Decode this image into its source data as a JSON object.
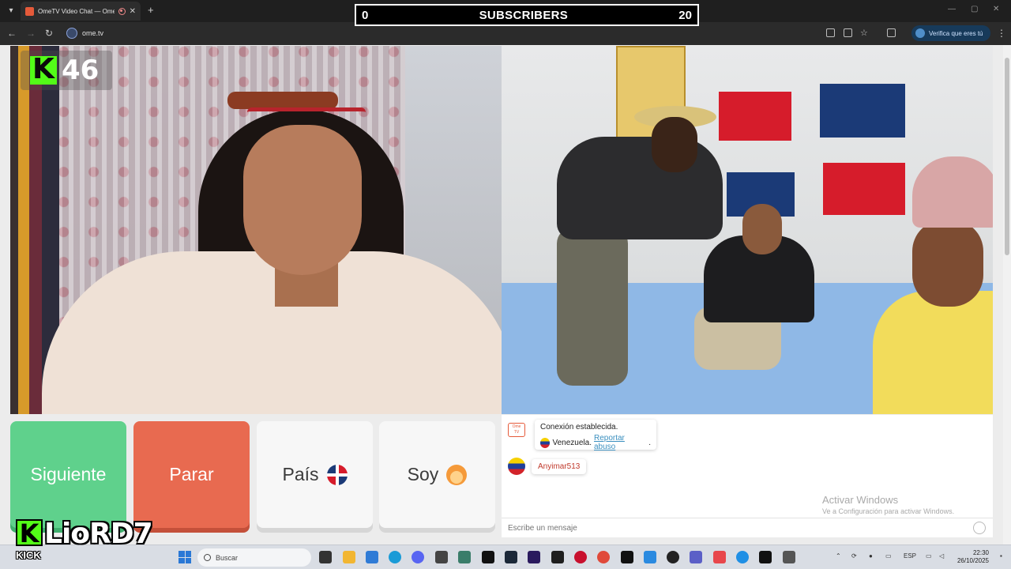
{
  "browser": {
    "tab_title": "OmeTV Video Chat — Ome",
    "url": "ome.tv",
    "verify_label": "Verifica que eres tú"
  },
  "overlay": {
    "left_count": "0",
    "label": "SUBSCRIBERS",
    "right_count": "20"
  },
  "kick_badge": {
    "count": "46"
  },
  "controls": {
    "next_label": "Siguiente",
    "stop_label": "Parar",
    "country_label": "País",
    "gender_label": "Soy"
  },
  "chat": {
    "system_message": "Conexión establecida.",
    "country": "Venezuela.",
    "report_link": "Reportar abuso",
    "report_suffix": ".",
    "username": "Anyimar513",
    "input_placeholder": "Escribe un mensaje",
    "activate_title": "Activar Windows",
    "activate_subtitle": "Ve a Configuración para activar Windows."
  },
  "watermark": {
    "streamer_name": "LioRD7",
    "platform": "KICK"
  },
  "taskbar": {
    "search_placeholder": "Buscar",
    "language": "ESP",
    "time": "22:30",
    "date": "26/10/2025"
  },
  "colors": {
    "next": "#5fd18c",
    "stop": "#e86a50",
    "kick_green": "#53fc18"
  }
}
